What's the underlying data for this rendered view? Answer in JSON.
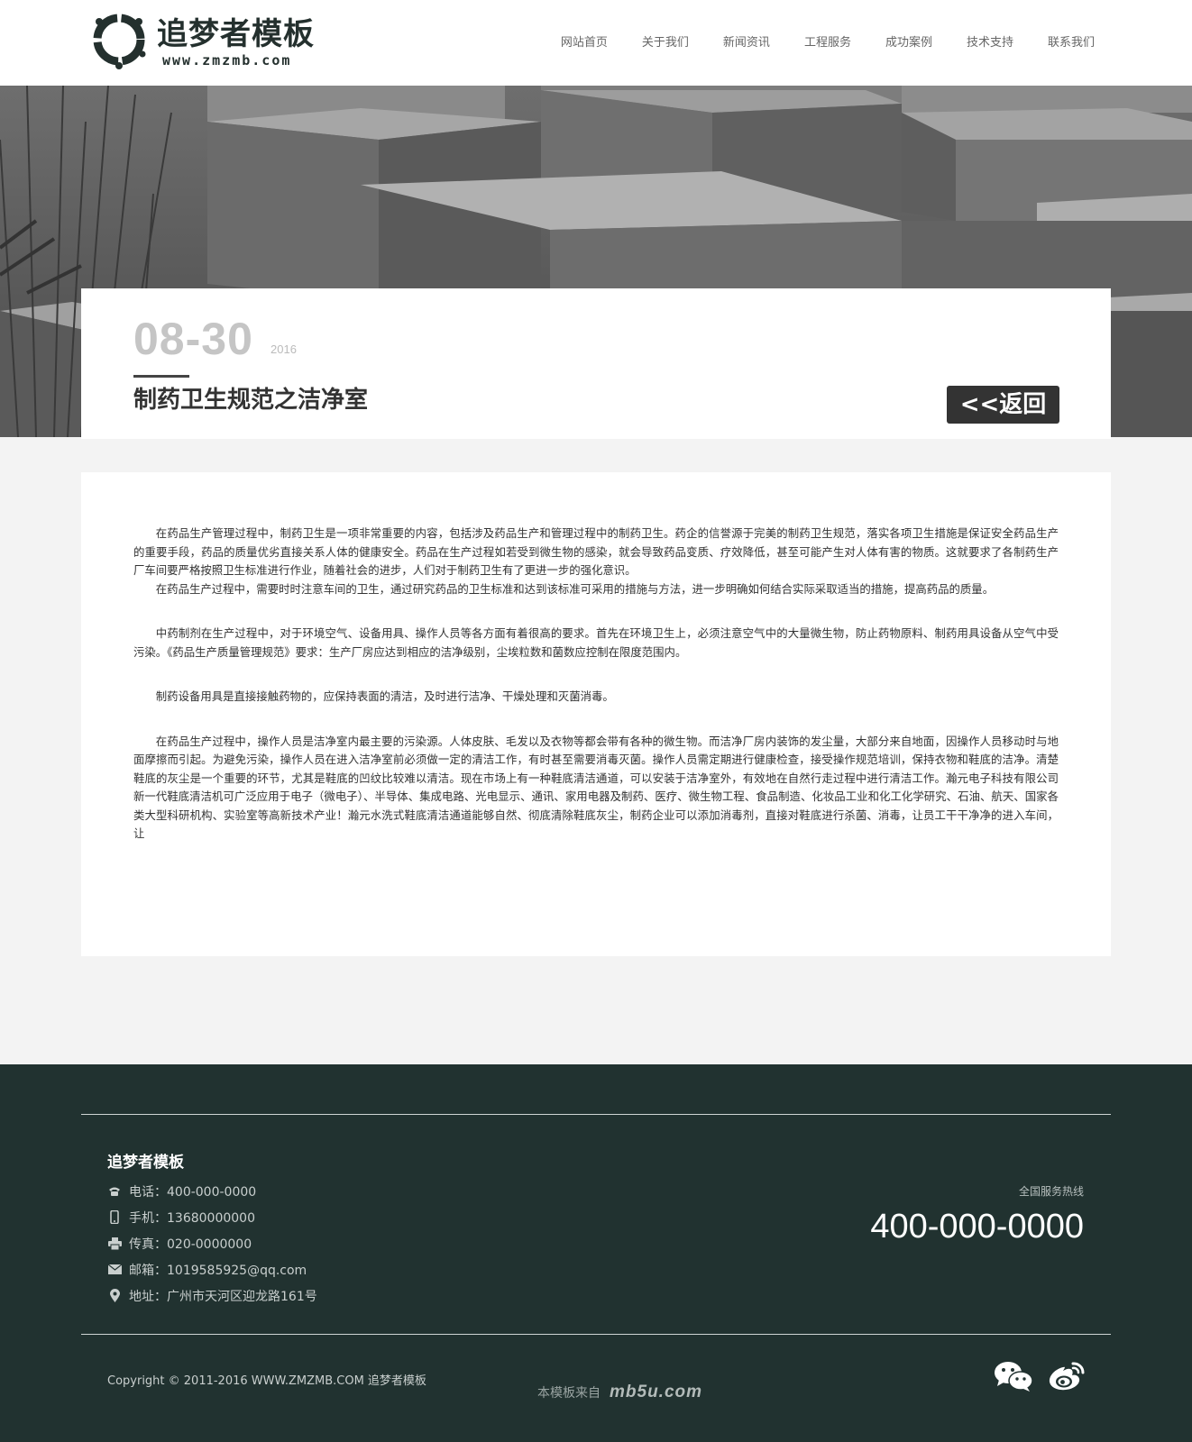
{
  "header": {
    "logo_title": "追梦者模板",
    "logo_sub": "www.zmzmb.com",
    "nav": [
      "网站首页",
      "关于我们",
      "新闻资讯",
      "工程服务",
      "成功案例",
      "技术支持",
      "联系我们"
    ]
  },
  "article": {
    "date": "08-30",
    "year": "2016",
    "title": "制药卫生规范之洁净室",
    "back_label": "<<返回",
    "paragraphs": [
      "在药品生产管理过程中，制药卫生是一项非常重要的内容，包括涉及药品生产和管理过程中的制药卫生。药企的信誉源于完美的制药卫生规范，落实各项卫生措施是保证安全药品生产的重要手段，药品的质量优劣直接关系人体的健康安全。药品在生产过程如若受到微生物的感染，就会导致药品变质、疗效降低，甚至可能产生对人体有害的物质。这就要求了各制药生产厂车间要严格按照卫生标准进行作业，随着社会的进步，人们对于制药卫生有了更进一步的强化意识。",
      "在药品生产过程中，需要时时注意车间的卫生，通过研究药品的卫生标准和达到该标准可采用的措施与方法，进一步明确如何结合实际采取适当的措施，提高药品的质量。",
      "中药制剂在生产过程中，对于环境空气、设备用具、操作人员等各方面有着很高的要求。首先在环境卫生上，必须注意空气中的大量微生物，防止药物原料、制药用具设备从空气中受污染。《药品生产质量管理规范》要求：生产厂房应达到相应的洁净级别，尘埃粒数和菌数应控制在限度范围内。",
      "制药设备用具是直接接触药物的，应保持表面的清洁，及时进行洁净、干燥处理和灭菌消毒。",
      "在药品生产过程中，操作人员是洁净室内最主要的污染源。人体皮肤、毛发以及衣物等都会带有各种的微生物。而洁净厂房内装饰的发尘量，大部分来自地面，因操作人员移动时与地面摩擦而引起。为避免污染，操作人员在进入洁净室前必须做一定的清洁工作，有时甚至需要消毒灭菌。操作人员需定期进行健康检查，接受操作规范培训，保持衣物和鞋底的洁净。清楚鞋底的灰尘是一个重要的环节，尤其是鞋底的凹纹比较难以清洁。现在市场上有一种鞋底清洁通道，可以安装于洁净室外，有效地在自然行走过程中进行清洁工作。瀚元电子科技有限公司新一代鞋底清洁机可广泛应用于电子（微电子）、半导体、集成电路、光电显示、通讯、家用电器及制药、医疗、微生物工程、食品制造、化妆品工业和化工化学研究、石油、航天、国家各类大型科研机构、实验室等高新技术产业！瀚元水洗式鞋底清洁通道能够自然、彻底清除鞋底灰尘，制药企业可以添加消毒剂，直接对鞋底进行杀菌、消毒，让员工干干净净的进入车间，让"
    ]
  },
  "footer": {
    "company": "追梦者模板",
    "contacts": [
      {
        "icon": "phone-icon",
        "text": "电话：400-000-0000"
      },
      {
        "icon": "mobile-icon",
        "text": "手机：13680000000"
      },
      {
        "icon": "fax-icon",
        "text": "传真：020-0000000"
      },
      {
        "icon": "mail-icon",
        "text": "邮箱：1019585925@qq.com"
      },
      {
        "icon": "location-icon",
        "text": "地址：广州市天河区迎龙路161号"
      }
    ],
    "hotline_label": "全国服务热线",
    "hotline": "400-000-0000",
    "copyright": "Copyright © 2011-2016 WWW.ZMZMB.COM 追梦者模板",
    "credit_prefix": "本模板来自",
    "credit_brand": "mb5u.com"
  },
  "colors": {
    "footer_bg": "#213230",
    "brand_dark": "#24302e",
    "back_button": "#333333",
    "page_bg": "#f3f3f3"
  }
}
